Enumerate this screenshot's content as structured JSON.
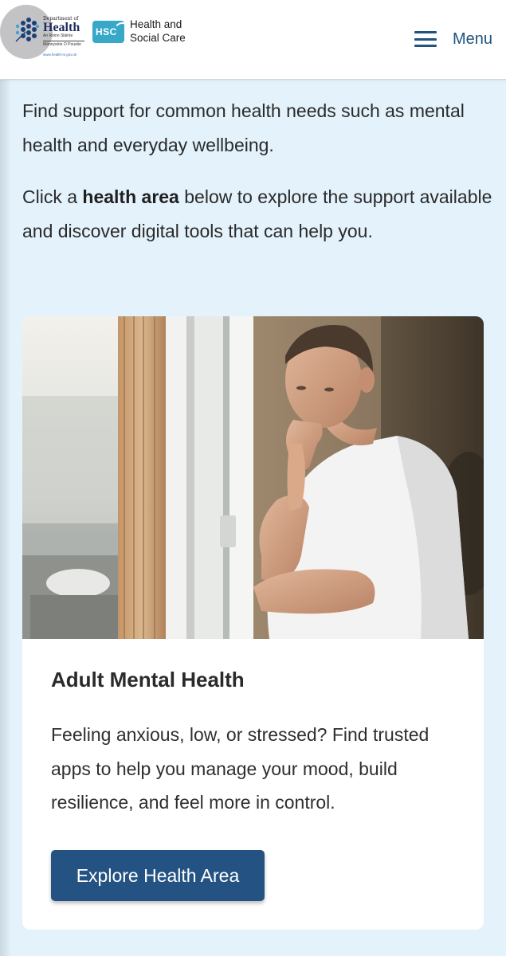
{
  "header": {
    "doh": {
      "top_small": "Department of",
      "name": "Health",
      "irish": "An Roinn Sláinte",
      "ulster_scots": "Männystrie O Poustie",
      "url": "www.health-ni.gov.uk"
    },
    "hsc": {
      "badge": "HSC",
      "line1": "Health and",
      "line2": "Social Care"
    },
    "menu_label": "Menu"
  },
  "intro": {
    "paragraph1": "Find support for common health needs such as mental health and everyday wellbeing.",
    "paragraph2_before": "Click a ",
    "paragraph2_bold": "health area",
    "paragraph2_after": " below to explore the support available and discover digital tools that can help you."
  },
  "card": {
    "title": "Adult Mental Health",
    "description": "Feeling anxious, low, or stressed? Find trusted apps to help you manage your mood, build resilience, and feel more in control.",
    "button_label": "Explore Health Area"
  },
  "colors": {
    "page_background": "#e3f2fb",
    "primary_blue": "#245383",
    "hsc_teal": "#38a8c9"
  }
}
